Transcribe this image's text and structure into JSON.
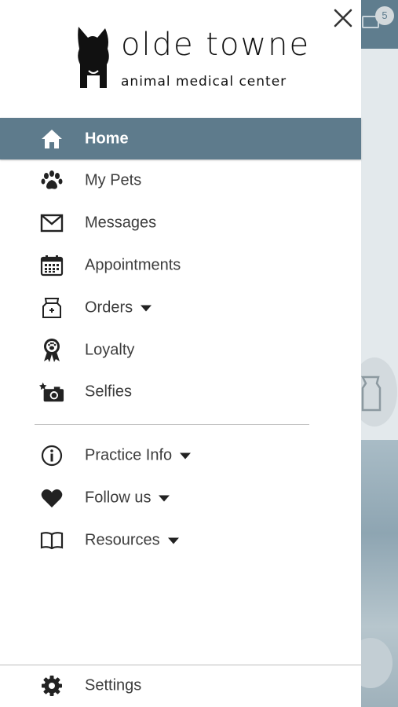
{
  "colors": {
    "active_bg": "#5e7b8c",
    "text": "#3c3c3c",
    "icon": "#222222",
    "divider": "#bdbdbd"
  },
  "background_app": {
    "badge_count": "5"
  },
  "drawer": {
    "close_icon": "close-icon",
    "logo": {
      "title": "olde towne",
      "subtitle": "animal medical center"
    },
    "items": [
      {
        "label": "Home",
        "icon": "home-icon"
      },
      {
        "label": "My Pets",
        "icon": "paw-icon"
      },
      {
        "label": "Messages",
        "icon": "envelope-icon"
      },
      {
        "label": "Appointments",
        "icon": "calendar-icon"
      },
      {
        "label": "Orders",
        "icon": "food-bag-icon"
      },
      {
        "label": "Loyalty",
        "icon": "award-ribbon-icon"
      },
      {
        "label": "Selfies",
        "icon": "camera-star-icon"
      }
    ],
    "secondary_items": [
      {
        "label": "Practice Info",
        "icon": "info-icon"
      },
      {
        "label": "Follow us",
        "icon": "heart-icon"
      },
      {
        "label": "Resources",
        "icon": "book-icon"
      }
    ],
    "settings": {
      "label": "Settings",
      "icon": "gear-icon"
    }
  }
}
